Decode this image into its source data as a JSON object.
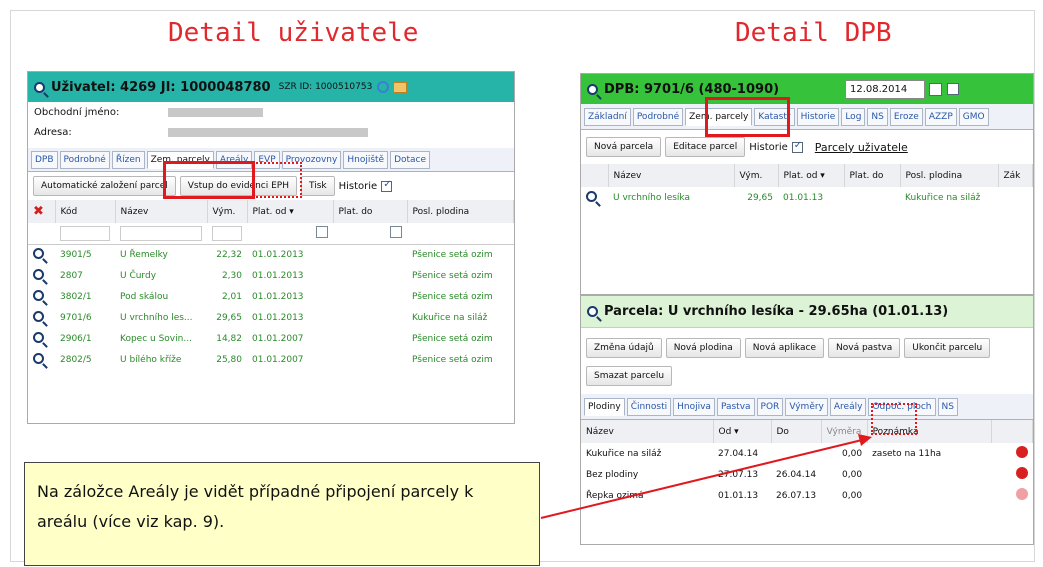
{
  "left_caption": "Detail uživatele",
  "right_caption": "Detail DPB",
  "user": {
    "title": "Uživatel: 4269 JI: 1000048780",
    "szr": "SZR ID: 1000510753",
    "name_label": "Obchodní jméno:",
    "address_label": "Adresa:",
    "tabs": [
      "DPB",
      "Podrobné",
      "Řízen",
      "Zem. parcely",
      "Areály",
      "EVP",
      "Provozovny",
      "Hnojiště",
      "Dotace"
    ],
    "buttons": [
      "Automatické založení parcel",
      "Vstup do evidenci EPH",
      "Tisk"
    ],
    "history_label": "Historie",
    "cols": [
      "Kód",
      "Název",
      "Vým.",
      "Plat. od ▾",
      "Plat. do",
      "Posl. plodina"
    ],
    "rows": [
      [
        "3901/5",
        "U Řemelky",
        "22,32",
        "01.01.2013",
        "",
        "Pšenice setá ozim"
      ],
      [
        "2807",
        "U Čurdy",
        "2,30",
        "01.01.2013",
        "",
        "Pšenice setá ozim"
      ],
      [
        "3802/1",
        "Pod skálou",
        "2,01",
        "01.01.2013",
        "",
        "Pšenice setá ozim"
      ],
      [
        "9701/6",
        "U vrchního les...",
        "29,65",
        "01.01.2013",
        "",
        "Kukuřice na siláž"
      ],
      [
        "2906/1",
        "Kopec u Sovin...",
        "14,82",
        "01.01.2007",
        "",
        "Pšenice setá ozim"
      ],
      [
        "2802/5",
        "U bílého kříže",
        "25,80",
        "01.01.2007",
        "",
        "Pšenice setá ozim"
      ]
    ]
  },
  "dpb": {
    "title": "DPB: 9701/6 (480-1090)",
    "date": "12.08.2014",
    "tabs": [
      "Základní",
      "Podrobné",
      "Zem. parcely",
      "Katastr",
      "Historie",
      "Log",
      "NS",
      "Eroze",
      "AZZP",
      "GMO"
    ],
    "buttons": [
      "Nová parcela",
      "Editace parcel"
    ],
    "history_label": "Historie",
    "user_parcels_link": "Parcely uživatele",
    "cols": [
      "Název",
      "Vým.",
      "Plat. od ▾",
      "Plat. do",
      "Posl. plodina",
      "Zák"
    ],
    "rows": [
      [
        "U vrchního lesíka",
        "29,65",
        "01.01.13",
        "",
        "Kukuřice na siláž"
      ]
    ]
  },
  "parcel": {
    "title": "Parcela: U vrchního lesíka - 29.65ha (01.01.13)",
    "buttons_row1": [
      "Změna údajů",
      "Nová plodina",
      "Nová aplikace",
      "Nová pastva",
      "Ukončit parcelu"
    ],
    "buttons_row2": [
      "Smazat parcelu"
    ],
    "tabs": [
      "Plodiny",
      "Činnosti",
      "Hnojiva",
      "Pastva",
      "POR",
      "Výměry",
      "Areály",
      "Odpoč. ploch",
      "NS"
    ],
    "cols": [
      "Název",
      "Od ▾",
      "Do",
      "Výměra",
      "Poznámka"
    ],
    "rows": [
      [
        "Kukuřice na siláž",
        "27.04.14",
        "",
        "0,00",
        "zaseto na 11ha"
      ],
      [
        "Bez plodiny",
        "27.07.13",
        "26.04.14",
        "0,00",
        ""
      ],
      [
        "Řepka ozimá",
        "01.01.13",
        "26.07.13",
        "0,00",
        ""
      ]
    ]
  },
  "note_text": "Na záložce Areály je vidět případné připojení parcely k areálu (více viz kap. 9)."
}
